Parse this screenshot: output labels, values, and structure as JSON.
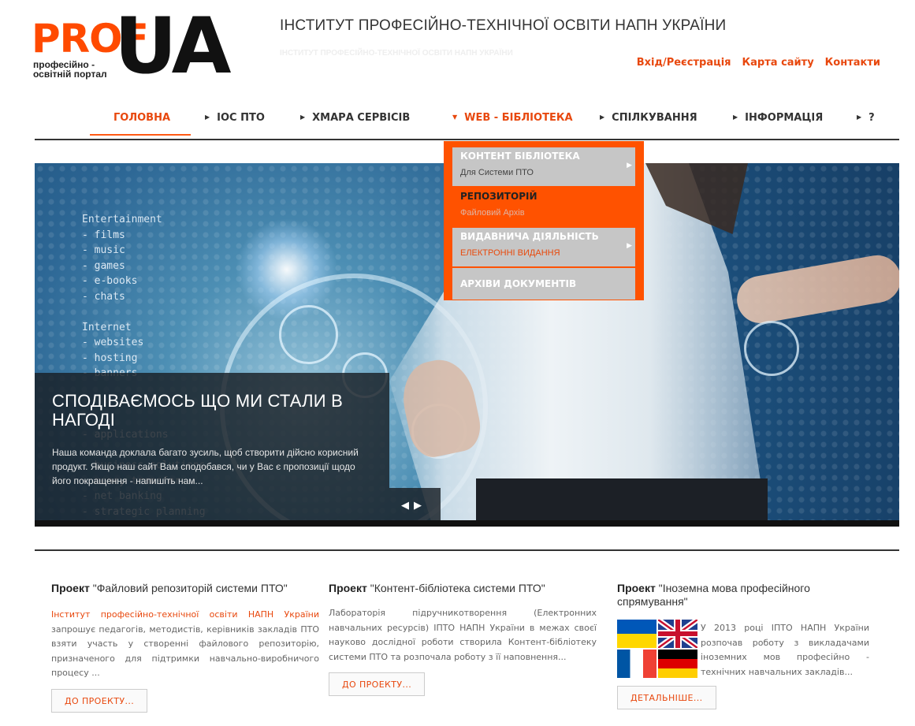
{
  "header": {
    "logo_prof": "PROF",
    "logo_ua": "UA",
    "logo_sub_line1": "професійно -",
    "logo_sub_line2": "освітній портал",
    "site_title": "ІНСТИТУТ ПРОФЕСІЙНО-ТЕХНІЧНОЇ ОСВІТИ НАПН УКРАЇНИ",
    "site_title_ghost": "ІНСТИТУТ ПРОФЕСІЙНО-ТЕХНІЧНОЇ ОСВІТИ НАПН УКРАЇНИ",
    "links": [
      "Вхід/Реєстрація",
      "Карта сайту",
      "Контакти"
    ]
  },
  "nav": {
    "items": [
      "ГОЛОВНА",
      "ІОС ПТО",
      "ХМАРА СЕРВІСІВ",
      "WEB - БІБЛІОТЕКА",
      "СПІЛКУВАННЯ",
      "ІНФОРМАЦІЯ",
      "?"
    ],
    "active_index": 0,
    "open_index": 3
  },
  "dropdown": {
    "items": [
      {
        "title": "КОНТЕНТ БІБЛІОТЕКА",
        "sub": "Для Системи ПТО"
      },
      {
        "title": "РЕПОЗИТОРІЙ",
        "sub": "Файловий Архів"
      },
      {
        "title": "ВИДАВНИЧА ДІЯЛЬНІСТЬ",
        "sub": "ЕЛЕКТРОННІ ВИДАННЯ"
      },
      {
        "title": "АРХІВИ ДОКУМЕНТІВ",
        "sub": ""
      }
    ]
  },
  "slider": {
    "code_lines": "Entertainment\n- films\n- music\n- games\n- e-books\n- chats\n\nInternet\n- websites\n- hosting\n- banners\n\n\n\n- applications\n\n- business solutions\n- money transfer\n- net banking\n- strategic planning",
    "caption_title": "СПОДІВАЄМОСЬ ЩО МИ СТАЛИ В НАГОДІ",
    "caption_text": "Наша команда доклала багато зусиль, щоб створити дійсно корисний продукт. Якщо наш сайт Вам сподобався, чи у Вас є пропозиції щодо його покращення - напишіть нам...",
    "prev": "◀",
    "next": "▶"
  },
  "projects": [
    {
      "label": "Проект",
      "title": "\"Файловий репозиторій системи ПТО\"",
      "highlight": "Інститут професійно-технічної освіти НАПН України",
      "body": " запрошує педагогів, методистів, керівників закладів ПТО взяти участь у створенні файлового репозиторію, призначеного для підтримки навчально-виробничого процесу ...",
      "button": "ДО ПРОЕКТУ..."
    },
    {
      "label": "Проект",
      "title": "\"Контент-бібліотека системи ПТО\"",
      "body": "Лабораторія підручникотворення (Електронних навчальних ресурсів) ІПТО НАПН України в межах своєї науково дослідної роботи створила Контент-бібліотеку системи ПТО та розпочала роботу з її наповнення...",
      "button": "ДО ПРОЕКТУ..."
    },
    {
      "label": "Проект",
      "title": "\"Іноземна мова професійного спрямування\"",
      "body": "У 2013 році ІПТО НАПН України розпочав роботу з викладачами іноземних мов професійно - технічних навчальних закладів...",
      "button": "ДЕТАЛЬНІШЕ..."
    }
  ],
  "colors": {
    "accent": "#e8480e",
    "dropdown_bg": "#ff5200",
    "dropdown_item_bg": "#c6c6c6"
  }
}
